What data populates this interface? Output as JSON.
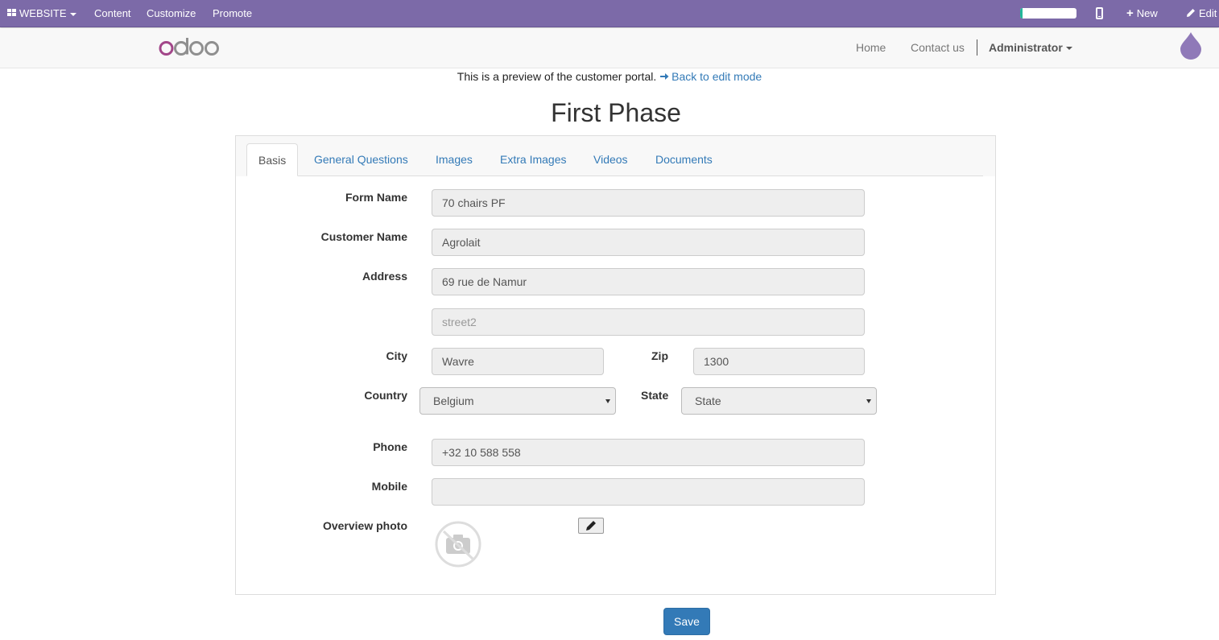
{
  "topbar": {
    "website_label": "WEBSITE",
    "content_label": "Content",
    "customize_label": "Customize",
    "promote_label": "Promote",
    "new_label": "New",
    "edit_label": "Edit",
    "progress_fraction": 0.04,
    "bg_color": "#7c6aa8",
    "progress_color": "#21b799"
  },
  "header": {
    "logo_text": "odoo",
    "nav": {
      "home": "Home",
      "contact": "Contact us",
      "user": "Administrator"
    }
  },
  "preview": {
    "text": "This is a preview of the customer portal.",
    "link": "Back to edit mode"
  },
  "page_title": "First Phase",
  "tabs": [
    {
      "label": "Basis",
      "active": true
    },
    {
      "label": "General Questions"
    },
    {
      "label": "Images"
    },
    {
      "label": "Extra Images"
    },
    {
      "label": "Videos"
    },
    {
      "label": "Documents"
    }
  ],
  "form": {
    "form_name": {
      "label": "Form Name",
      "value": "70 chairs PF"
    },
    "customer_name": {
      "label": "Customer Name",
      "value": "Agrolait"
    },
    "address": {
      "label": "Address",
      "value": "69 rue de Namur",
      "street2_placeholder": "street2"
    },
    "city": {
      "label": "City",
      "value": "Wavre"
    },
    "zip": {
      "label": "Zip",
      "value": "1300"
    },
    "country": {
      "label": "Country",
      "value": "Belgium"
    },
    "state": {
      "label": "State",
      "value": "State"
    },
    "phone": {
      "label": "Phone",
      "value": "+32 10 588 558"
    },
    "mobile": {
      "label": "Mobile",
      "value": ""
    },
    "overview_photo": {
      "label": "Overview photo"
    }
  },
  "save_label": "Save",
  "link_color": "#337ab7"
}
